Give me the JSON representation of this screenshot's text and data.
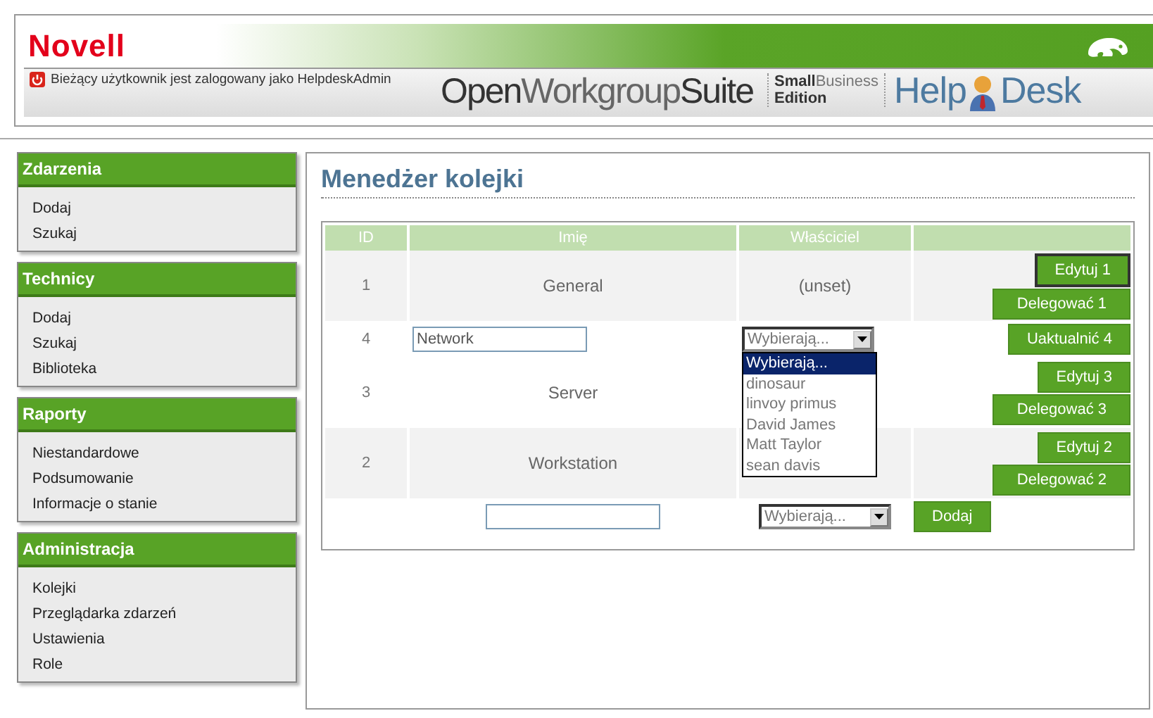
{
  "header": {
    "brand": "Novell",
    "user_text": "Bieżący użytkownik jest zalogowany jako HelpdeskAdmin",
    "product": [
      {
        "text": "Open",
        "kind": "strong"
      },
      {
        "text": "Workgroup",
        "kind": "light"
      },
      {
        "text": "Suite",
        "kind": "strong"
      }
    ],
    "edition": [
      {
        "text": "Small",
        "kind": "strong"
      },
      {
        "text": "Business",
        "kind": "light"
      },
      {
        "text": "Edition",
        "kind": "strong"
      }
    ],
    "helpdesk": [
      "Help",
      "Desk"
    ]
  },
  "sidebar": [
    {
      "title": "Zdarzenia",
      "items": [
        "Dodaj",
        "Szukaj"
      ]
    },
    {
      "title": "Technicy",
      "items": [
        "Dodaj",
        "Szukaj",
        "Biblioteka"
      ]
    },
    {
      "title": "Raporty",
      "items": [
        "Niestandardowe",
        "Podsumowanie",
        "Informacje o stanie"
      ]
    },
    {
      "title": "Administracja",
      "items": [
        "Kolejki",
        "Przeglądarka zdarzeń",
        "Ustawienia",
        "Role"
      ]
    }
  ],
  "main": {
    "title": "Menedżer kolejki",
    "table": {
      "columns": [
        "ID",
        "Imię",
        "Właściciel"
      ],
      "rows": [
        {
          "kind": "view",
          "shaded": true,
          "id": "1",
          "name": "General",
          "owner": "(unset)",
          "buttons": [
            {
              "label": "Edytuj 1",
              "focused": true
            },
            {
              "label": "Delegować 1",
              "focused": false
            }
          ]
        },
        {
          "kind": "edit",
          "shaded": false,
          "id": "4",
          "name": "Network",
          "owner": "Wybierają...",
          "expanded": true,
          "options": [
            {
              "label": "Wybierają...",
              "selected": true
            },
            {
              "label": "dinosaur",
              "selected": false
            },
            {
              "label": "linvoy primus",
              "selected": false
            },
            {
              "label": "David James",
              "selected": false
            },
            {
              "label": "Matt Taylor",
              "selected": false
            },
            {
              "label": "sean davis",
              "selected": false
            }
          ],
          "buttons": [
            {
              "label": "Uaktualnić 4",
              "focused": false
            }
          ]
        },
        {
          "kind": "view",
          "shaded": false,
          "id": "3",
          "name": "Server",
          "buttons": [
            {
              "label": "Edytuj 3",
              "focused": false
            },
            {
              "label": "Delegować 3",
              "focused": false
            }
          ]
        },
        {
          "kind": "view",
          "shaded": true,
          "id": "2",
          "name": "Workstation",
          "buttons": [
            {
              "label": "Edytuj 2",
              "focused": false
            },
            {
              "label": "Delegować 2",
              "focused": false
            }
          ]
        },
        {
          "kind": "add",
          "shaded": false,
          "owner": "Wybierają...",
          "buttons": [
            {
              "label": "Dodaj",
              "focused": false
            }
          ]
        }
      ]
    }
  }
}
